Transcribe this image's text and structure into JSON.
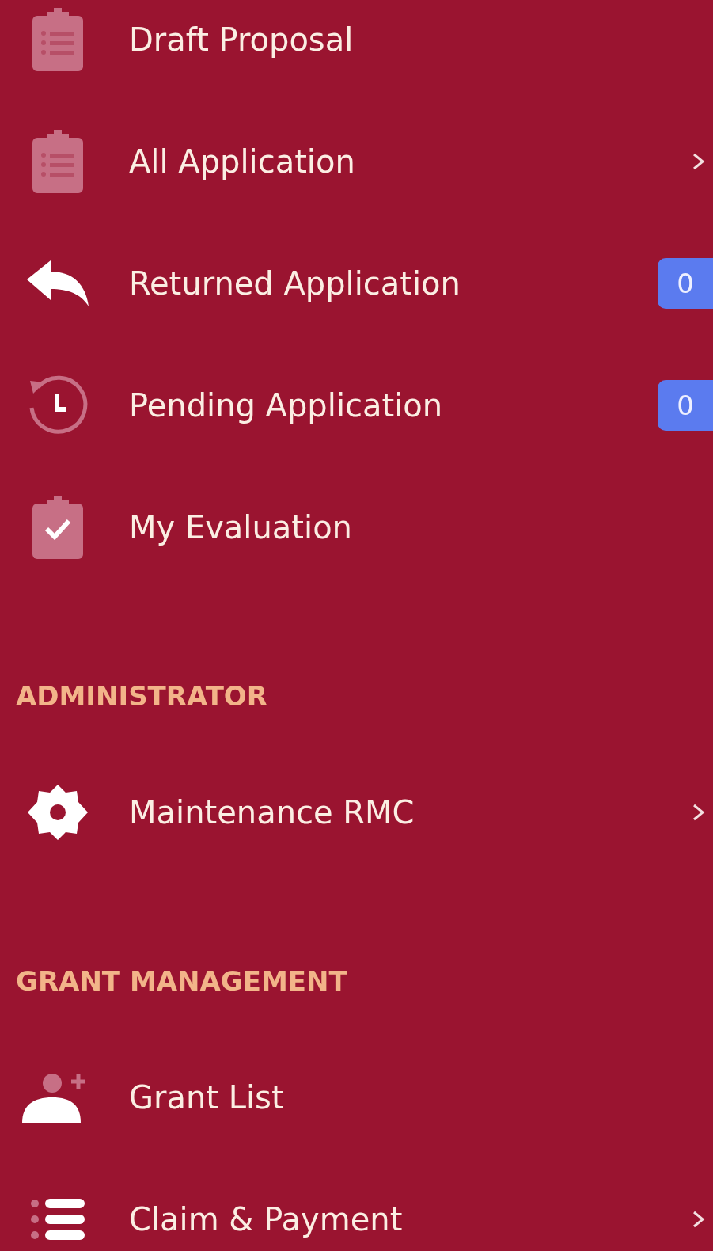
{
  "sections": [
    {
      "items": [
        {
          "label": "Draft Proposal",
          "kind": "clipboard-list",
          "expandable": false
        },
        {
          "label": "All Application",
          "kind": "clipboard-list",
          "expandable": true
        },
        {
          "label": "Returned Application",
          "kind": "reply",
          "expandable": false,
          "badge": "0"
        },
        {
          "label": "Pending Application",
          "kind": "history",
          "expandable": false,
          "badge": "0"
        },
        {
          "label": "My Evaluation",
          "kind": "clipboard-check",
          "expandable": false
        }
      ]
    },
    {
      "heading": "ADMINISTRATOR",
      "items": [
        {
          "label": "Maintenance RMC",
          "kind": "gear",
          "expandable": true
        }
      ]
    },
    {
      "heading": "GRANT MANAGEMENT",
      "items": [
        {
          "label": "Grant List",
          "kind": "user-plus",
          "expandable": false
        },
        {
          "label": "Claim & Payment",
          "kind": "list",
          "expandable": true
        }
      ]
    }
  ]
}
